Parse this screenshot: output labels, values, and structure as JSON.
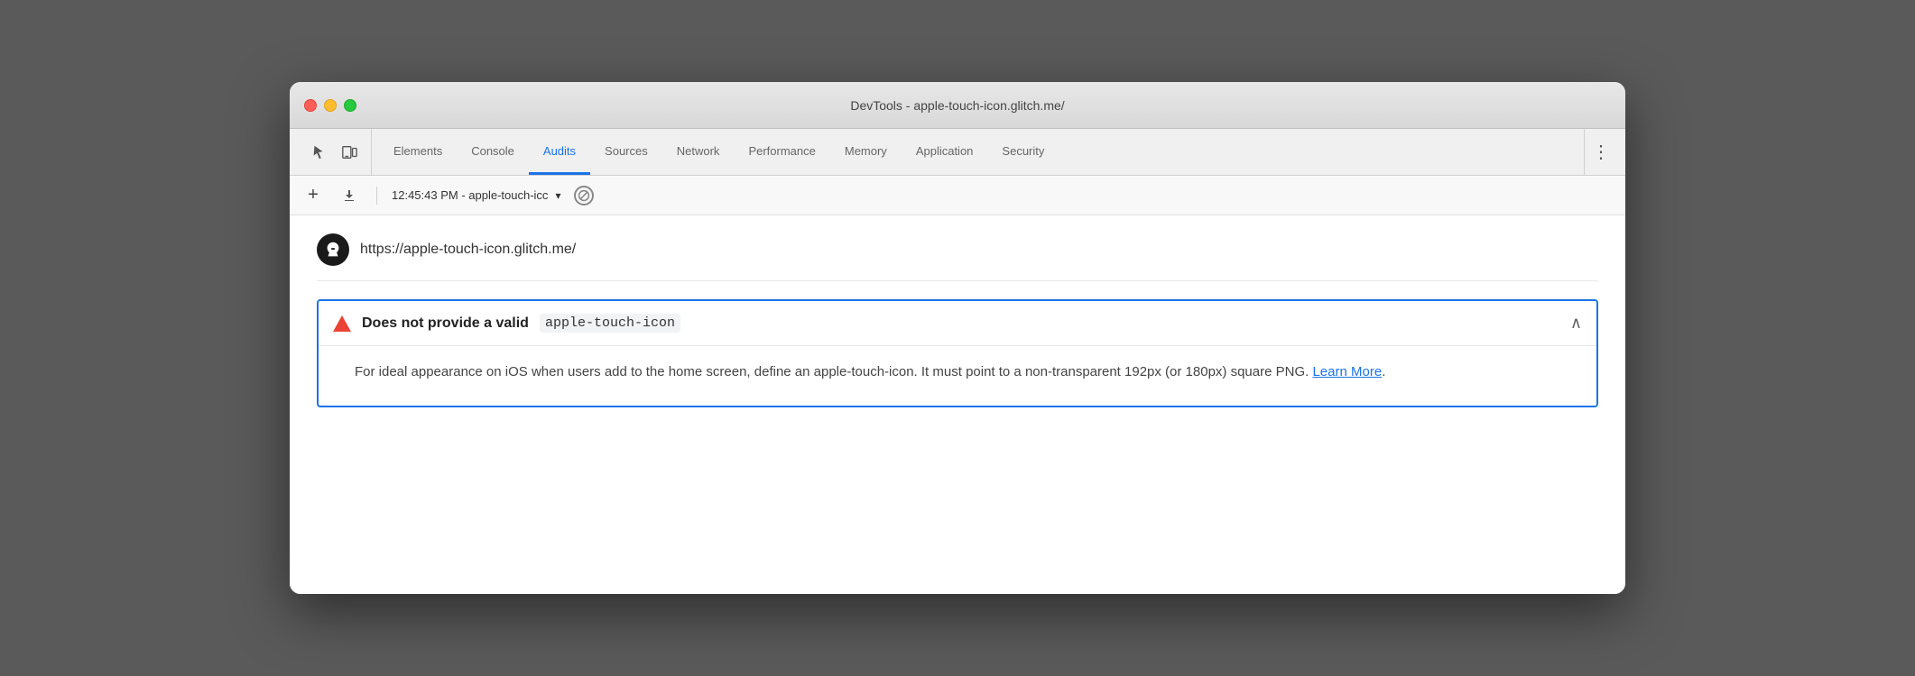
{
  "window": {
    "title": "DevTools - apple-touch-icon.glitch.me/"
  },
  "tabs": [
    {
      "id": "elements",
      "label": "Elements",
      "active": false
    },
    {
      "id": "console",
      "label": "Console",
      "active": false
    },
    {
      "id": "audits",
      "label": "Audits",
      "active": true
    },
    {
      "id": "sources",
      "label": "Sources",
      "active": false
    },
    {
      "id": "network",
      "label": "Network",
      "active": false
    },
    {
      "id": "performance",
      "label": "Performance",
      "active": false
    },
    {
      "id": "memory",
      "label": "Memory",
      "active": false
    },
    {
      "id": "application",
      "label": "Application",
      "active": false
    },
    {
      "id": "security",
      "label": "Security",
      "active": false
    }
  ],
  "secondary_toolbar": {
    "plus_label": "+",
    "download_label": "↓",
    "audit_name": "12:45:43 PM - apple-touch-icc",
    "no_icon": "⊘"
  },
  "url_bar": {
    "url": "https://apple-touch-icon.glitch.me/"
  },
  "warning": {
    "title_plain": "Does not provide a valid",
    "title_code": "apple-touch-icon",
    "body": "For ideal appearance on iOS when users add to the home screen, define an apple-touch-icon. It must point to a non-transparent 192px (or 180px) square PNG.",
    "learn_more_text": "Learn More",
    "period": "."
  },
  "colors": {
    "active_tab": "#1a73e8",
    "warning_border": "#ea4335",
    "link": "#1a73e8"
  }
}
